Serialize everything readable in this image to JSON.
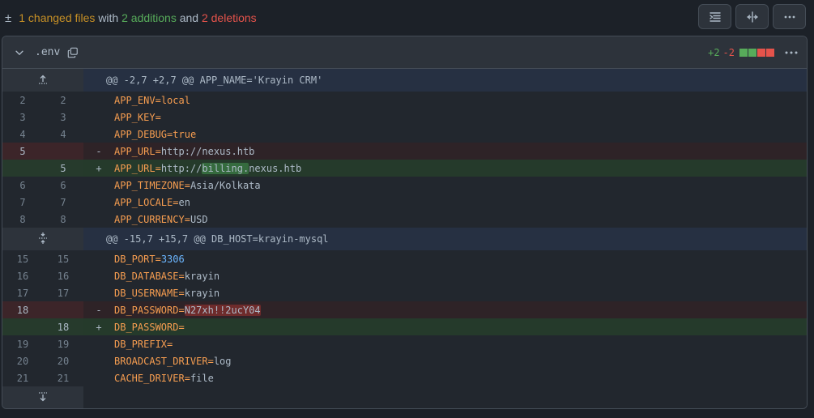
{
  "summary": {
    "changed": "1 changed files",
    "with": "with",
    "additions": "2 additions",
    "and": "and",
    "deletions": "2 deletions"
  },
  "file": {
    "name": ".env",
    "stat_add": "+2",
    "stat_del": "-2",
    "bar_colors": [
      "#57ab5a",
      "#57ab5a",
      "#e5534b",
      "#e5534b"
    ]
  },
  "hunks": [
    "@@ -2,7 +2,7 @@ APP_NAME='Krayin CRM'",
    "@@ -15,7 +15,7 @@ DB_HOST=krayin-mysql"
  ],
  "lines": [
    {
      "old": "2",
      "new": "2",
      "sign": "",
      "key": "APP_ENV",
      "eq": "=",
      "val": "local",
      "pre": "",
      "hl": "",
      "post": ""
    },
    {
      "old": "3",
      "new": "3",
      "sign": "",
      "key": "APP_KEY",
      "eq": "=",
      "val": "",
      "pre": "",
      "hl": "",
      "post": ""
    },
    {
      "old": "4",
      "new": "4",
      "sign": "",
      "key": "APP_DEBUG",
      "eq": "=",
      "val": "true",
      "pre": "",
      "hl": "",
      "post": ""
    },
    {
      "old": "5",
      "new": "",
      "sign": "-",
      "key": "APP_URL",
      "eq": "=",
      "val": "",
      "pre": "http://nexus.htb",
      "hl": "",
      "post": ""
    },
    {
      "old": "",
      "new": "5",
      "sign": "+",
      "key": "APP_URL",
      "eq": "=",
      "val": "",
      "pre": "http://",
      "hl": "billing.",
      "post": "nexus.htb"
    },
    {
      "old": "6",
      "new": "6",
      "sign": "",
      "key": "APP_TIMEZONE",
      "eq": "=",
      "val": "",
      "pre": "Asia/Kolkata",
      "hl": "",
      "post": ""
    },
    {
      "old": "7",
      "new": "7",
      "sign": "",
      "key": "APP_LOCALE",
      "eq": "=",
      "val": "",
      "pre": "en",
      "hl": "",
      "post": ""
    },
    {
      "old": "8",
      "new": "8",
      "sign": "",
      "key": "APP_CURRENCY",
      "eq": "=",
      "val": "",
      "pre": "USD",
      "hl": "",
      "post": ""
    },
    {
      "old": "15",
      "new": "15",
      "sign": "",
      "key": "DB_PORT",
      "eq": "=",
      "val": "",
      "num": "3306",
      "pre": "",
      "hl": "",
      "post": ""
    },
    {
      "old": "16",
      "new": "16",
      "sign": "",
      "key": "DB_DATABASE",
      "eq": "=",
      "val": "",
      "pre": "krayin",
      "hl": "",
      "post": ""
    },
    {
      "old": "17",
      "new": "17",
      "sign": "",
      "key": "DB_USERNAME",
      "eq": "=",
      "val": "",
      "pre": "krayin",
      "hl": "",
      "post": ""
    },
    {
      "old": "18",
      "new": "",
      "sign": "-",
      "key": "DB_PASSWORD",
      "eq": "=",
      "val": "",
      "pre": "",
      "hl": "N27xh!!2ucY04",
      "post": ""
    },
    {
      "old": "",
      "new": "18",
      "sign": "+",
      "key": "DB_PASSWORD",
      "eq": "=",
      "val": "",
      "pre": "",
      "hl": "",
      "post": ""
    },
    {
      "old": "19",
      "new": "19",
      "sign": "",
      "key": "DB_PREFIX",
      "eq": "=",
      "val": "",
      "pre": "",
      "hl": "",
      "post": ""
    },
    {
      "old": "20",
      "new": "20",
      "sign": "",
      "key": "BROADCAST_DRIVER",
      "eq": "=",
      "val": "",
      "pre": "log",
      "hl": "",
      "post": ""
    },
    {
      "old": "21",
      "new": "21",
      "sign": "",
      "key": "CACHE_DRIVER",
      "eq": "=",
      "val": "",
      "pre": "file",
      "hl": "",
      "post": ""
    }
  ],
  "icons": {
    "toolbar": [
      "indent-icon",
      "split-view-icon",
      "kebab-icon"
    ],
    "expand": [
      "expand-up-icon",
      "expand-both-icon",
      "expand-down-icon"
    ]
  }
}
